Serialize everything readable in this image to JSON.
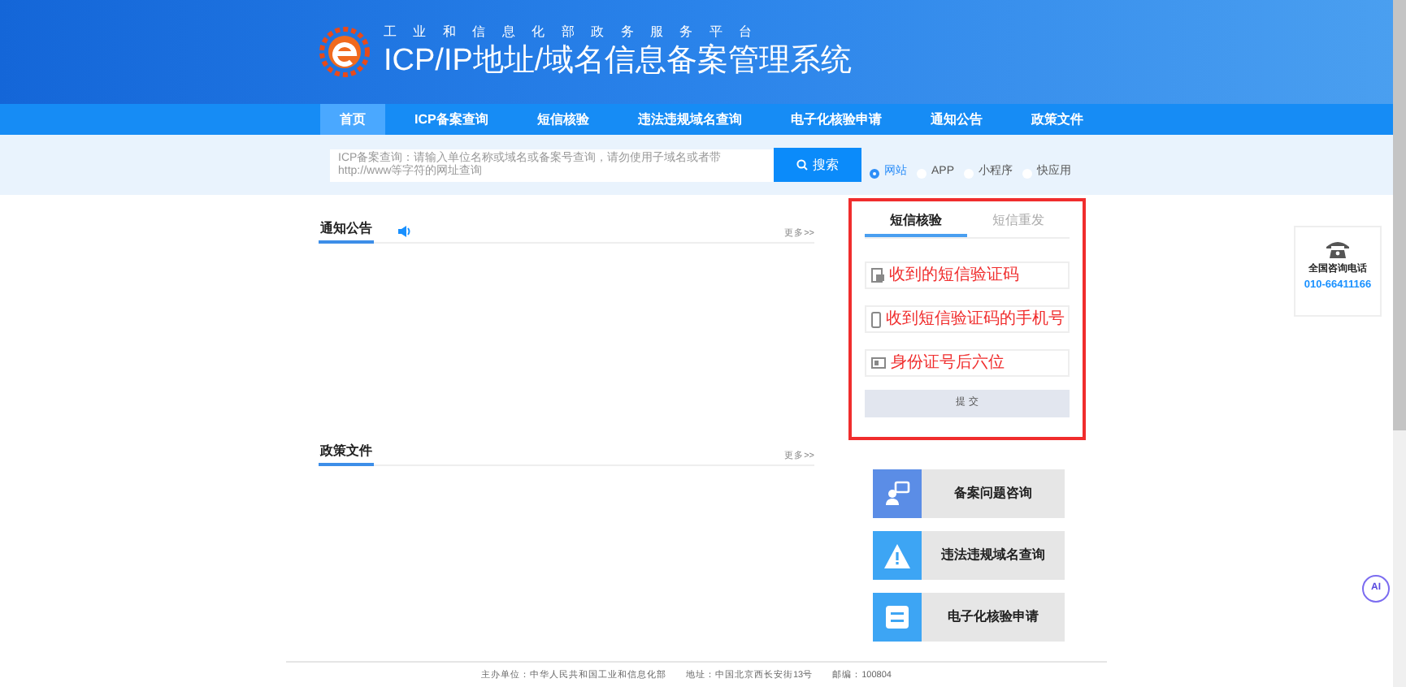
{
  "header": {
    "subtitle": "工 业 和 信 息 化 部 政 务 服 务 平 台",
    "title": "ICP/IP地址/域名信息备案管理系统"
  },
  "nav": [
    {
      "label": "首页",
      "selected": true
    },
    {
      "label": "ICP备案查询",
      "selected": false
    },
    {
      "label": "短信核验",
      "selected": false
    },
    {
      "label": "违法违规域名查询",
      "selected": false
    },
    {
      "label": "电子化核验申请",
      "selected": false
    },
    {
      "label": "通知公告",
      "selected": false
    },
    {
      "label": "政策文件",
      "selected": false
    }
  ],
  "search": {
    "placeholder": "ICP备案查询：请输入单位名称或域名或备案号查询，请勿使用子域名或者带http://www等字符的网址查询",
    "button": "搜索",
    "types": [
      {
        "label": "网站",
        "selected": true
      },
      {
        "label": "APP",
        "selected": false
      },
      {
        "label": "小程序",
        "selected": false
      },
      {
        "label": "快应用",
        "selected": false
      }
    ]
  },
  "notices": {
    "title": "通知公告",
    "more": "更多>>"
  },
  "policies": {
    "title": "政策文件",
    "more": "更多>>"
  },
  "sms_panel": {
    "tabs": [
      {
        "label": "短信核验",
        "selected": true
      },
      {
        "label": "短信重发",
        "selected": false
      }
    ],
    "fields": [
      {
        "kind": "code",
        "annotation": "收到的短信验证码"
      },
      {
        "kind": "phone",
        "annotation": "收到短信验证码的手机号"
      },
      {
        "kind": "id",
        "annotation": "身份证号后六位"
      }
    ],
    "submit": "提 交"
  },
  "quick_links": [
    {
      "kind": "consult",
      "label": "备案问题咨询",
      "color": "#5b8de6"
    },
    {
      "kind": "warning",
      "label": "违法违规域名查询",
      "color": "#3da5f4"
    },
    {
      "kind": "apply",
      "label": "电子化核验申请",
      "color": "#3da5f4"
    }
  ],
  "hotline": {
    "label": "全国咨询电话",
    "number": "010-66411166"
  },
  "ai_button": "AI",
  "footer": [
    "主办单位：中华人民共和国工业和信息化部",
    "地址：中国北京西长安街13号",
    "邮编：100804"
  ]
}
